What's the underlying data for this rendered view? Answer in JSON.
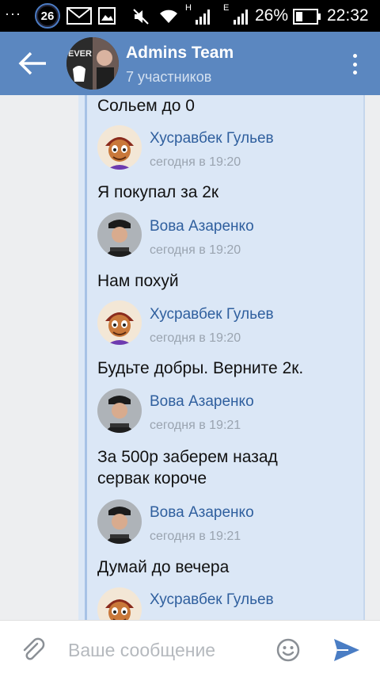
{
  "status_bar": {
    "dots": "···",
    "badge": "26",
    "net_letter_1": "H",
    "net_letter_2": "E",
    "battery_percent": "26%",
    "time": "22:32"
  },
  "header": {
    "title": "Admins Team",
    "subtitle": "7 участников",
    "avatar_text": "EVER"
  },
  "chat": {
    "first_text": "Сольем до 0",
    "messages": [
      {
        "author": "Хусравбек Гульев",
        "time": "сегодня в 19:20",
        "text": "Я покупал за 2к",
        "avatar": "aladdin"
      },
      {
        "author": "Вова Азаренко",
        "time": "сегодня в 19:20",
        "text": "Нам похуй",
        "avatar": "police"
      },
      {
        "author": "Хусравбек Гульев",
        "time": "сегодня в 19:20",
        "text": "Будьте добры. Верните 2к.",
        "avatar": "aladdin"
      },
      {
        "author": "Вова Азаренко",
        "time": "сегодня в 19:21",
        "text": "За 500р заберем назад\nсервак короче",
        "avatar": "police"
      },
      {
        "author": "Вова Азаренко",
        "time": "сегодня в 19:21",
        "text": "Думай до вечера",
        "avatar": "police"
      },
      {
        "author": "Хусравбек Гульев",
        "time": "",
        "text": "",
        "avatar": "aladdin"
      }
    ]
  },
  "composer": {
    "placeholder": "Ваше сообщение"
  },
  "colors": {
    "header": "#5b87c0",
    "forward_panel": "#dbe7f6",
    "author_name": "#2f5f9e",
    "send_icon": "#4a7dc4"
  }
}
